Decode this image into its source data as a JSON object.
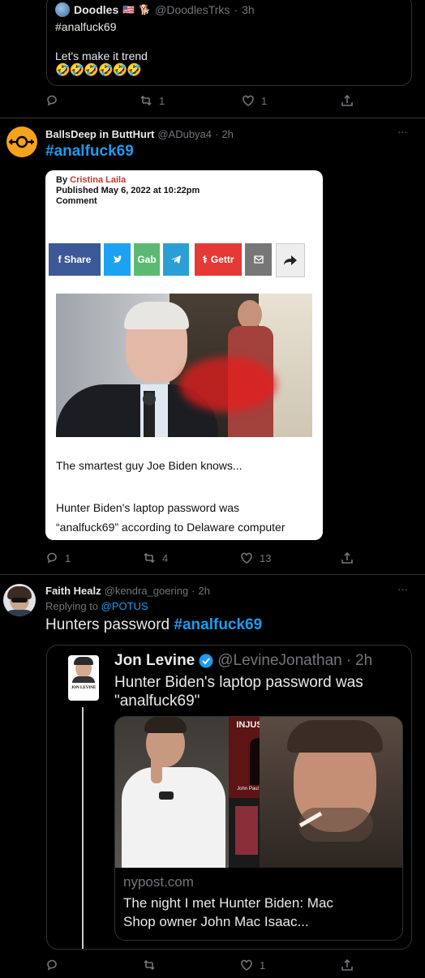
{
  "quote1": {
    "name": "Doodles",
    "flag_emoji": "🇺🇸",
    "dog_emoji": "🐕",
    "handle": "@DoodlesTrks",
    "time": "3h",
    "hashtag": "#analfuck69",
    "text": "Let's make it trend",
    "emoji_row": "🤣🤣🤣🤣🤣🤣"
  },
  "actions1": {
    "replies": "",
    "retweets": "1",
    "likes": "1"
  },
  "tweet2": {
    "name": "BallsDeep in ButtHurt",
    "handle": "@ADubya4",
    "time": "2h",
    "text": "#analfuck69",
    "more": "···",
    "article": {
      "by_prefix": "By",
      "author": "Cristina Laila",
      "published": "Published May 6, 2022 at 10:22pm",
      "comment": "Comment",
      "share_buttons": {
        "facebook": "f Share",
        "gab": "Gab",
        "gettr": "Gettr"
      },
      "caption1": "The smartest guy Joe Biden knows...",
      "caption2": "Hunter Biden's laptop password was",
      "caption3": "“analfuck69” according to Delaware computer"
    }
  },
  "actions2": {
    "replies": "1",
    "retweets": "4",
    "likes": "13"
  },
  "tweet3": {
    "name": "Faith Healz",
    "handle": "@kendra_goering",
    "time": "2h",
    "more": "···",
    "replying_prefix": "Replying to",
    "replying_to": "@POTUS",
    "text_plain": "Hunters password",
    "text_hashtag": "#analfuck69",
    "quote": {
      "name": "Jon Levine",
      "handle": "@LevineJonathan",
      "time": "2h",
      "text_line1": "Hunter Biden's laptop password was",
      "text_line2": "\"analfuck69\"",
      "avatar_caption": "JON LEVINE",
      "book_title": "INJUSTICE",
      "book_author": "John Paul Mac Isaac",
      "card_domain": "nypost.com",
      "card_title_line1": "The night I met Hunter Biden: Mac",
      "card_title_line2": "Shop owner John Mac Isaac..."
    }
  },
  "actions3": {
    "replies": "",
    "retweets": "",
    "likes": "1"
  },
  "colors": {
    "accent": "#1d9bf0",
    "background": "#000000",
    "muted": "#71767b",
    "border": "#2f3336",
    "avatar_orange": "#f7a21b"
  }
}
